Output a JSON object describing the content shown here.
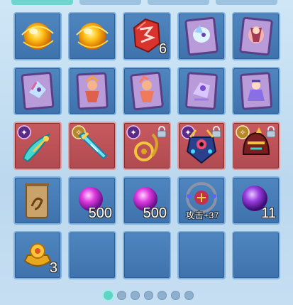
{
  "tabs": [
    {
      "label": "",
      "active": true
    },
    {
      "label": "",
      "active": false
    },
    {
      "label": "",
      "active": false
    },
    {
      "label": "",
      "active": false
    }
  ],
  "inventory": {
    "rows": [
      [
        {
          "item": "gold-orb-icon",
          "count": ""
        },
        {
          "item": "gold-orb-icon",
          "count": ""
        },
        {
          "item": "red-stone-icon",
          "count": "6"
        },
        {
          "item": "pet-card-icon",
          "count": ""
        },
        {
          "item": "pet-card-icon",
          "count": ""
        }
      ],
      [
        {
          "item": "pet-card-icon",
          "count": ""
        },
        {
          "item": "pet-card-icon",
          "count": ""
        },
        {
          "item": "pet-card-icon",
          "count": ""
        },
        {
          "item": "pet-card-icon",
          "count": ""
        },
        {
          "item": "pet-card-icon",
          "count": ""
        }
      ],
      [
        {
          "item": "feather-blade-icon",
          "locked": false
        },
        {
          "item": "crystal-sword-icon",
          "locked": false
        },
        {
          "item": "gold-rope-whip-icon",
          "locked": true
        },
        {
          "item": "jeweled-armor-icon",
          "locked": true
        },
        {
          "item": "dragon-helmet-icon",
          "locked": true
        }
      ],
      [
        {
          "item": "scroll-icon",
          "count": ""
        },
        {
          "item": "purple-orb-icon",
          "count": "500"
        },
        {
          "item": "purple-orb-icon",
          "count": "500"
        },
        {
          "item": "ring-accessory-icon",
          "count": "",
          "attribute": "攻击+37"
        },
        {
          "item": "purple-orb-icon",
          "count": "11"
        }
      ],
      [
        {
          "item": "gold-treasure-icon",
          "count": "3"
        },
        {
          "item": "empty",
          "count": ""
        },
        {
          "item": "empty",
          "count": ""
        },
        {
          "item": "empty",
          "count": ""
        },
        {
          "item": "empty",
          "count": ""
        }
      ]
    ]
  },
  "pager": {
    "pages": 7,
    "current": 1
  },
  "colors": {
    "slot": "#4a7fba",
    "slot_red": "#c0555a",
    "accent": "#5fd3c7"
  }
}
